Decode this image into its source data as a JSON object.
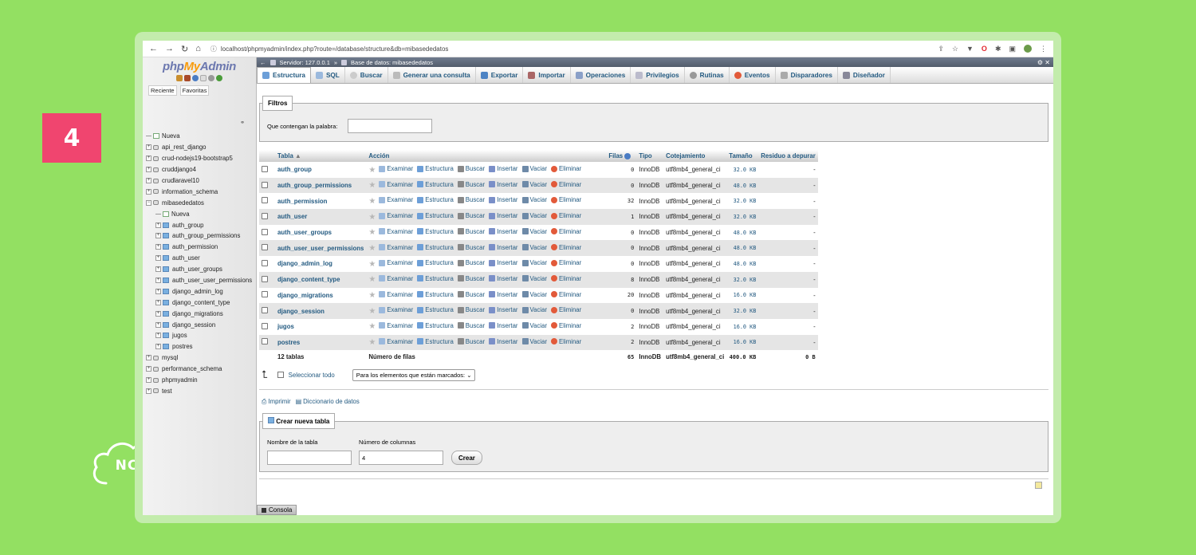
{
  "overlay": {
    "step_number": "4",
    "logo_text": "NC"
  },
  "browser": {
    "url": "localhost/phpmyadmin/index.php?route=/database/structure&db=mibasededatos"
  },
  "sidebar": {
    "logo_php": "php",
    "logo_my": "My",
    "logo_admin": "Admin",
    "tab_recent": "Reciente",
    "tab_favorites": "Favoritas",
    "new_label": "Nueva",
    "databases_before": [
      "api_rest_django",
      "crud-nodejs19-bootstrap5",
      "cruddjango4",
      "crudlaravel10",
      "information_schema"
    ],
    "open_db": "mibasededatos",
    "open_db_new": "Nueva",
    "open_db_tables": [
      "auth_group",
      "auth_group_permissions",
      "auth_permission",
      "auth_user",
      "auth_user_groups",
      "auth_user_user_permissions",
      "django_admin_log",
      "django_content_type",
      "django_migrations",
      "django_session",
      "jugos",
      "postres"
    ],
    "databases_after": [
      "mysql",
      "performance_schema",
      "phpmyadmin",
      "test"
    ]
  },
  "breadcrumb": {
    "server": "Servidor: 127.0.0.1",
    "separator": "»",
    "database": "Base de datos: mibasededatos"
  },
  "tabs": [
    "Estructura",
    "SQL",
    "Buscar",
    "Generar una consulta",
    "Exportar",
    "Importar",
    "Operaciones",
    "Privilegios",
    "Rutinas",
    "Eventos",
    "Disparadores",
    "Diseñador"
  ],
  "filters": {
    "legend": "Filtros",
    "label": "Que contengan la palabra:"
  },
  "table": {
    "headers": {
      "table": "Tabla",
      "action": "Acción",
      "rows": "Filas",
      "type": "Tipo",
      "collation": "Cotejamiento",
      "size": "Tamaño",
      "overhead": "Residuo a depurar"
    },
    "actions": [
      "Examinar",
      "Estructura",
      "Buscar",
      "Insertar",
      "Vaciar",
      "Eliminar"
    ],
    "rows": [
      {
        "name": "auth_group",
        "rows": "0",
        "type": "InnoDB",
        "collation": "utf8mb4_general_ci",
        "size": "32.0 KB",
        "overhead": "-"
      },
      {
        "name": "auth_group_permissions",
        "rows": "0",
        "type": "InnoDB",
        "collation": "utf8mb4_general_ci",
        "size": "48.0 KB",
        "overhead": "-"
      },
      {
        "name": "auth_permission",
        "rows": "32",
        "type": "InnoDB",
        "collation": "utf8mb4_general_ci",
        "size": "32.0 KB",
        "overhead": "-"
      },
      {
        "name": "auth_user",
        "rows": "1",
        "type": "InnoDB",
        "collation": "utf8mb4_general_ci",
        "size": "32.0 KB",
        "overhead": "-"
      },
      {
        "name": "auth_user_groups",
        "rows": "0",
        "type": "InnoDB",
        "collation": "utf8mb4_general_ci",
        "size": "48.0 KB",
        "overhead": "-"
      },
      {
        "name": "auth_user_user_permissions",
        "rows": "0",
        "type": "InnoDB",
        "collation": "utf8mb4_general_ci",
        "size": "48.0 KB",
        "overhead": "-"
      },
      {
        "name": "django_admin_log",
        "rows": "0",
        "type": "InnoDB",
        "collation": "utf8mb4_general_ci",
        "size": "48.0 KB",
        "overhead": "-"
      },
      {
        "name": "django_content_type",
        "rows": "8",
        "type": "InnoDB",
        "collation": "utf8mb4_general_ci",
        "size": "32.0 KB",
        "overhead": "-"
      },
      {
        "name": "django_migrations",
        "rows": "20",
        "type": "InnoDB",
        "collation": "utf8mb4_general_ci",
        "size": "16.0 KB",
        "overhead": "-"
      },
      {
        "name": "django_session",
        "rows": "0",
        "type": "InnoDB",
        "collation": "utf8mb4_general_ci",
        "size": "32.0 KB",
        "overhead": "-"
      },
      {
        "name": "jugos",
        "rows": "2",
        "type": "InnoDB",
        "collation": "utf8mb4_general_ci",
        "size": "16.0 KB",
        "overhead": "-"
      },
      {
        "name": "postres",
        "rows": "2",
        "type": "InnoDB",
        "collation": "utf8mb4_general_ci",
        "size": "16.0 KB",
        "overhead": "-"
      }
    ],
    "total": {
      "name": "12 tablas",
      "label": "Número de filas",
      "rows": "65",
      "type": "InnoDB",
      "collation": "utf8mb4_general_ci",
      "size": "400.0 KB",
      "overhead": "0 B"
    }
  },
  "select_bar": {
    "select_all": "Seleccionar todo",
    "with_selected": "Para los elementos que están marcados:"
  },
  "links": {
    "print": "Imprimir",
    "dictionary": "Diccionario de datos"
  },
  "create_table": {
    "legend": "Crear nueva tabla",
    "name_label": "Nombre de la tabla",
    "columns_label": "Número de columnas",
    "columns_value": "4",
    "button": "Crear"
  },
  "console": {
    "label": "Consola"
  },
  "colors": {
    "background": "#93e062",
    "badge": "#f0456f",
    "link": "#235a81"
  }
}
